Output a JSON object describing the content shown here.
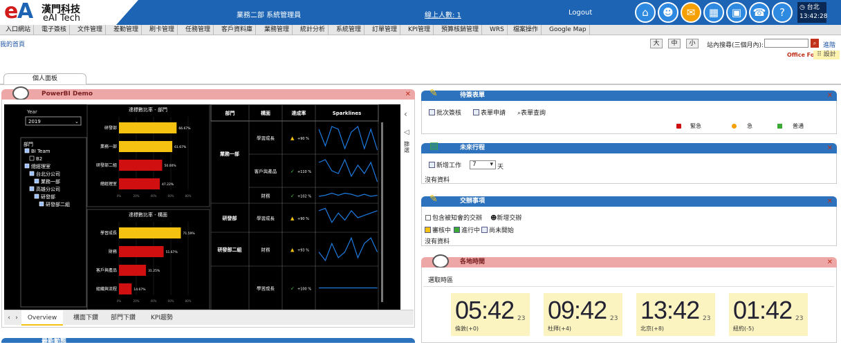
{
  "header": {
    "logo_cn": "漢門科技",
    "logo_en": "eAI Tech",
    "dept_user": "業務二部 系統管理員",
    "online_label": "線上人數: 1",
    "logout": "Logout",
    "city": "台北",
    "time": "13:42:28",
    "icons": [
      "home-icon",
      "user-icon",
      "mail-icon",
      "calendar-icon",
      "briefcase-icon",
      "phone-icon",
      "help-icon"
    ]
  },
  "menu": [
    "入口網站",
    "電子簽核",
    "文件管理",
    "差勤管理",
    "刷卡管理",
    "任務管理",
    "客戶資料庫",
    "業務管理",
    "統計分析",
    "系統管理",
    "訂單管理",
    "KPI管理",
    "預算核銷管理",
    "WRS",
    "檔案操作",
    "Google Map"
  ],
  "brand": "Office Force",
  "breadcrumb": "我的首頁",
  "size_buttons": [
    "大",
    "中",
    "小"
  ],
  "search": {
    "label": "站內搜尋(三個月內):",
    "placeholder": "",
    "advanced": "進階"
  },
  "design": "設計",
  "tabs": [
    "個人面板"
  ],
  "powerbi": {
    "title": "PowerBI Demo",
    "year_label": "Year",
    "year_value": "2019",
    "tree_title": "部門",
    "tree": [
      {
        "label": "BI Team",
        "level": 0
      },
      {
        "label": "B2",
        "level": 1
      },
      {
        "label": "總經理室",
        "level": 0
      },
      {
        "label": "台北分公司",
        "level": 1
      },
      {
        "label": "業務一部",
        "level": 2
      },
      {
        "label": "高雄分公司",
        "level": 1
      },
      {
        "label": "研發部",
        "level": 2
      },
      {
        "label": "研發部二組",
        "level": 3
      }
    ],
    "side_label": "篩選",
    "tabs": [
      "Overview",
      "構面下鑽",
      "部門下鑽",
      "KPI趨勢"
    ],
    "table": {
      "headers": [
        "部門",
        "構面",
        "達成率",
        "Sparklines"
      ],
      "rows": [
        {
          "dept": "",
          "face": "學習成長",
          "rate": "+90 %",
          "status": "warn"
        },
        {
          "dept": "業務一部",
          "face": "客戶與產品",
          "rate": "+110 %",
          "status": "ok"
        },
        {
          "dept": "",
          "face": "財務",
          "rate": "+102 %",
          "status": "ok"
        },
        {
          "dept": "研發部",
          "face": "學習成長",
          "rate": "+90 %",
          "status": "warn"
        },
        {
          "dept": "研發部二組",
          "face": "財務",
          "rate": "+93 %",
          "status": "warn"
        },
        {
          "dept": "",
          "face": "學習成長",
          "rate": "+100 %",
          "status": "ok"
        }
      ]
    }
  },
  "chart_data": [
    {
      "type": "bar",
      "title": "達標數比率 - 部門",
      "categories": [
        "研發部",
        "業務一部",
        "研發部二組",
        "總經理室"
      ],
      "values": [
        66.67,
        61.67,
        50.0,
        47.22
      ],
      "labels": [
        "66.67%",
        "61.67%",
        "50.00%",
        "47.22%"
      ],
      "colors": [
        "#f5c211",
        "#f5c211",
        "#d01010",
        "#d01010"
      ],
      "xlim": [
        0,
        100
      ],
      "ticks": [
        "0%",
        "20%",
        "40%",
        "60%",
        "80%"
      ]
    },
    {
      "type": "bar",
      "title": "達標數比率 - 構面",
      "categories": [
        "學習成長",
        "財務",
        "客戶與產品",
        "組織與流程"
      ],
      "values": [
        71.59,
        51.67,
        31.25,
        14.67
      ],
      "labels": [
        "71.59%",
        "51.67%",
        "31.25%",
        "14.67%"
      ],
      "colors": [
        "#f5c211",
        "#d01010",
        "#d01010",
        "#d01010"
      ],
      "xlim": [
        0,
        100
      ],
      "ticks": [
        "0%",
        "20%",
        "40%",
        "60%",
        "80%"
      ]
    }
  ],
  "pending": {
    "title": "待簽表單",
    "tools": [
      "批次簽核",
      "表單申請",
      "表單查詢"
    ],
    "legend": [
      {
        "label": "緊急",
        "color": "#d01010"
      },
      {
        "label": "急",
        "color": "#f5a000"
      },
      {
        "label": "普通",
        "color": "#3aaa35"
      }
    ]
  },
  "schedule": {
    "title": "未來行程",
    "add": "新增工作",
    "days": "7",
    "unit": "天",
    "empty": "沒有資料"
  },
  "tasks": {
    "title": "交辦事項",
    "include": "包含被知會的交辦",
    "add": "新增交辦",
    "filters": [
      "審核中",
      "進行中",
      "尚未開始"
    ],
    "empty": "沒有資料"
  },
  "worldtime": {
    "title": "各地時間",
    "select": "選取時區",
    "clocks": [
      {
        "time": "05:42",
        "sec": "23",
        "city": "倫敦(+0)"
      },
      {
        "time": "09:42",
        "sec": "23",
        "city": "杜拜(+4)"
      },
      {
        "time": "13:42",
        "sec": "23",
        "city": "北京(+8)"
      },
      {
        "time": "01:42",
        "sec": "23",
        "city": "紐約(-5)"
      }
    ]
  },
  "bottom_title": "最新動態"
}
